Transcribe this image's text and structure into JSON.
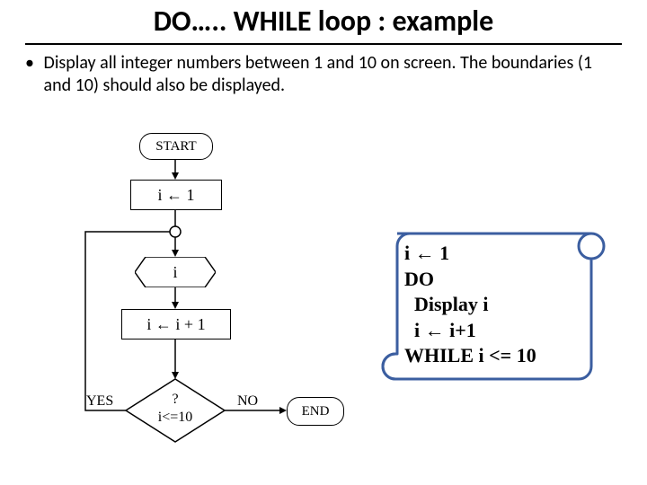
{
  "title": "DO….. WHILE loop : example",
  "bullet": "Display all integer numbers between 1 and 10 on screen. The boundaries (1 and 10) should also be displayed.",
  "flow": {
    "start": "START",
    "init": "i ← 1",
    "output": "i",
    "step": "i ← i + 1",
    "decision_top": "?",
    "decision_bottom": "i<=10",
    "yes": "YES",
    "no": "NO",
    "end": "END"
  },
  "pseudocode": {
    "l1": "i ← 1",
    "l2": "DO",
    "l3": "  Display i",
    "l4": "  i ← i+1",
    "l5": "WHILE i <= 10"
  }
}
